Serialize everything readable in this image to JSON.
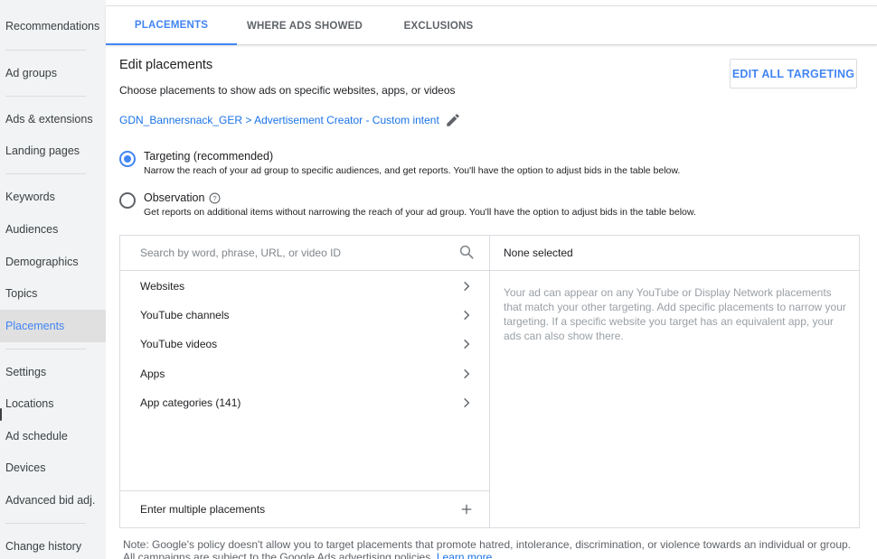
{
  "sidebar": {
    "items": [
      {
        "label": "Recommendations"
      },
      {
        "label": "Ad groups"
      },
      {
        "label": "Ads & extensions"
      },
      {
        "label": "Landing pages"
      },
      {
        "label": "Keywords"
      },
      {
        "label": "Audiences"
      },
      {
        "label": "Demographics"
      },
      {
        "label": "Topics"
      },
      {
        "label": "Placements"
      },
      {
        "label": "Settings"
      },
      {
        "label": "Locations"
      },
      {
        "label": "Ad schedule"
      },
      {
        "label": "Devices"
      },
      {
        "label": "Advanced bid adj."
      },
      {
        "label": "Change history"
      }
    ],
    "active": "Placements"
  },
  "tabs": [
    {
      "label": "PLACEMENTS"
    },
    {
      "label": "WHERE ADS SHOWED"
    },
    {
      "label": "EXCLUSIONS"
    }
  ],
  "edit": {
    "title": "Edit placements",
    "description": "Choose placements to show ads on specific websites, apps, or videos",
    "edit_all_label": "EDIT ALL TARGETING",
    "breadcrumb": "GDN_Bannersnack_GER > Advertisement Creator - Custom intent"
  },
  "radios": {
    "targeting": {
      "label": "Targeting (recommended)",
      "description": "Narrow the reach of your ad group to specific audiences, and get reports. You'll have the option to adjust bids in the table below."
    },
    "observation": {
      "label": "Observation",
      "description": "Get reports on additional items without narrowing the reach of your ad group. You'll have the option to adjust bids in the table below."
    },
    "selected": "targeting"
  },
  "panel": {
    "search_placeholder": "Search by word, phrase, URL, or video ID",
    "categories": [
      {
        "label": "Websites"
      },
      {
        "label": "YouTube channels"
      },
      {
        "label": "YouTube videos"
      },
      {
        "label": "Apps"
      },
      {
        "label": "App categories (141)"
      }
    ],
    "enter_multiple_label": "Enter multiple placements",
    "selected_header": "None selected",
    "selected_description": "Your ad can appear on any YouTube or Display Network placements that match your other targeting. Add specific placements to narrow your targeting. If a specific website you target has an equivalent app, your ads can also show there."
  },
  "note": {
    "text": "Note: Google's policy doesn't allow you to target placements that promote hatred, intolerance, discrimination, or violence towards an individual or group. All campaigns are subject to the Google Ads advertising policies.",
    "link_label": "Learn more"
  },
  "colors": {
    "accent": "#4285f4",
    "link": "#1a73e8",
    "sidebar_bg": "#f1f3f4",
    "active_bg": "#e0e0e0"
  }
}
